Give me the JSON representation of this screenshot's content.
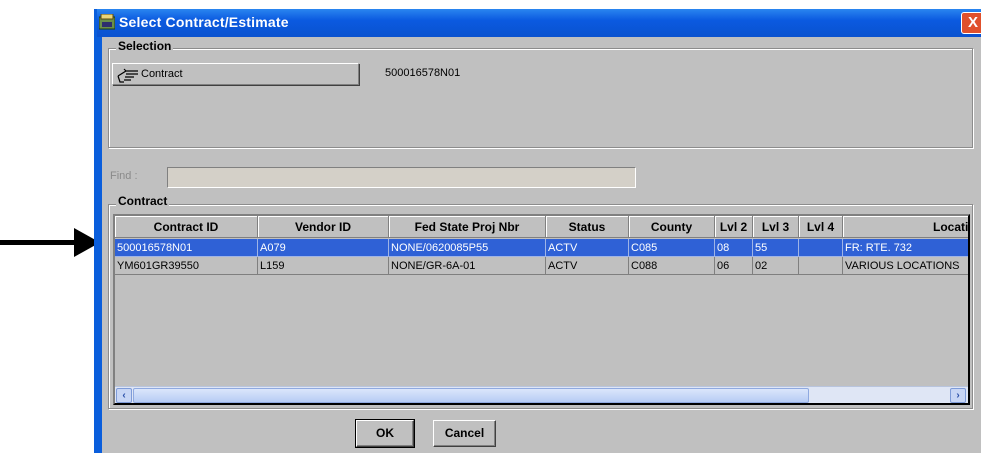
{
  "window": {
    "title": "Select Contract/Estimate",
    "close_label": "X",
    "app_icon": "app-window-icon"
  },
  "selection": {
    "legend": "Selection",
    "button_label": "Contract",
    "button_icon": "pointing-hand-icon",
    "value": "500016578N01"
  },
  "find": {
    "label": "Find :",
    "value": ""
  },
  "contract": {
    "legend": "Contract",
    "columns": [
      "Contract ID",
      "Vendor ID",
      "Fed State Proj Nbr",
      "Status",
      "County",
      "Lvl 2",
      "Lvl 3",
      "Lvl 4",
      "Location"
    ],
    "rows": [
      [
        "500016578N01",
        "A079",
        "NONE/0620085P55",
        "ACTV",
        "C085",
        "08",
        "55",
        "",
        "FR: RTE. 732"
      ],
      [
        "YM601GR39550",
        "L159",
        "NONE/GR-6A-01",
        "ACTV",
        "C088",
        "06",
        "02",
        "",
        "VARIOUS LOCATIONS"
      ]
    ],
    "selected_row": 0
  },
  "buttons": {
    "ok": "OK",
    "cancel": "Cancel"
  },
  "colors": {
    "title_bar": "#0b5ae0",
    "selected_row": "#2f61d6",
    "dialog_bg": "#c0c0c0"
  }
}
